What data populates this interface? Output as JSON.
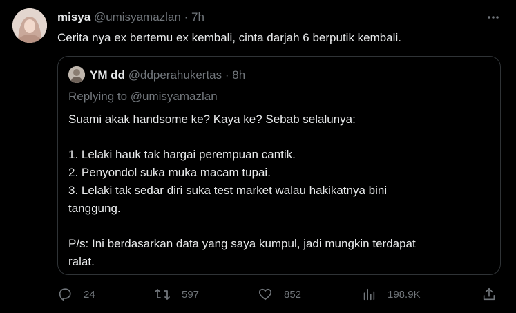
{
  "tweet": {
    "author": {
      "display_name": "misya",
      "handle": "@umisyamazlan",
      "time": "7h",
      "avatar_icon": "profile-photo"
    },
    "separator": "·",
    "more_icon": "more-horizontal-icon",
    "text": "Cerita nya ex bertemu ex kembali, cinta darjah 6 berputik kembali."
  },
  "quoted": {
    "author": {
      "display_name": "YM dd",
      "handle": "@ddperahukertas",
      "time": "8h",
      "avatar_icon": "profile-photo"
    },
    "replying_prefix": "Replying to ",
    "replying_handle": "@umisyamazlan",
    "lines": [
      "Suami akak handsome ke? Kaya ke? Sebab selalunya:",
      "",
      "1. Lelaki hauk tak hargai perempuan cantik.",
      "2. Penyondol suka muka macam tupai.",
      "3. Lelaki tak sedar diri suka test market walau hakikatnya bini",
      "tanggung.",
      "",
      "P/s: Ini berdasarkan data yang saya kumpul, jadi mungkin terdapat",
      "ralat."
    ]
  },
  "actions": {
    "reply": {
      "icon": "reply-icon",
      "count": "24"
    },
    "retweet": {
      "icon": "retweet-icon",
      "count": "597"
    },
    "like": {
      "icon": "heart-icon",
      "count": "852"
    },
    "views": {
      "icon": "views-icon",
      "count": "198.9K"
    },
    "share": {
      "icon": "share-icon"
    }
  },
  "colors": {
    "background": "#000000",
    "text": "#e7e9ea",
    "muted": "#71767b",
    "border": "#2f3336"
  }
}
